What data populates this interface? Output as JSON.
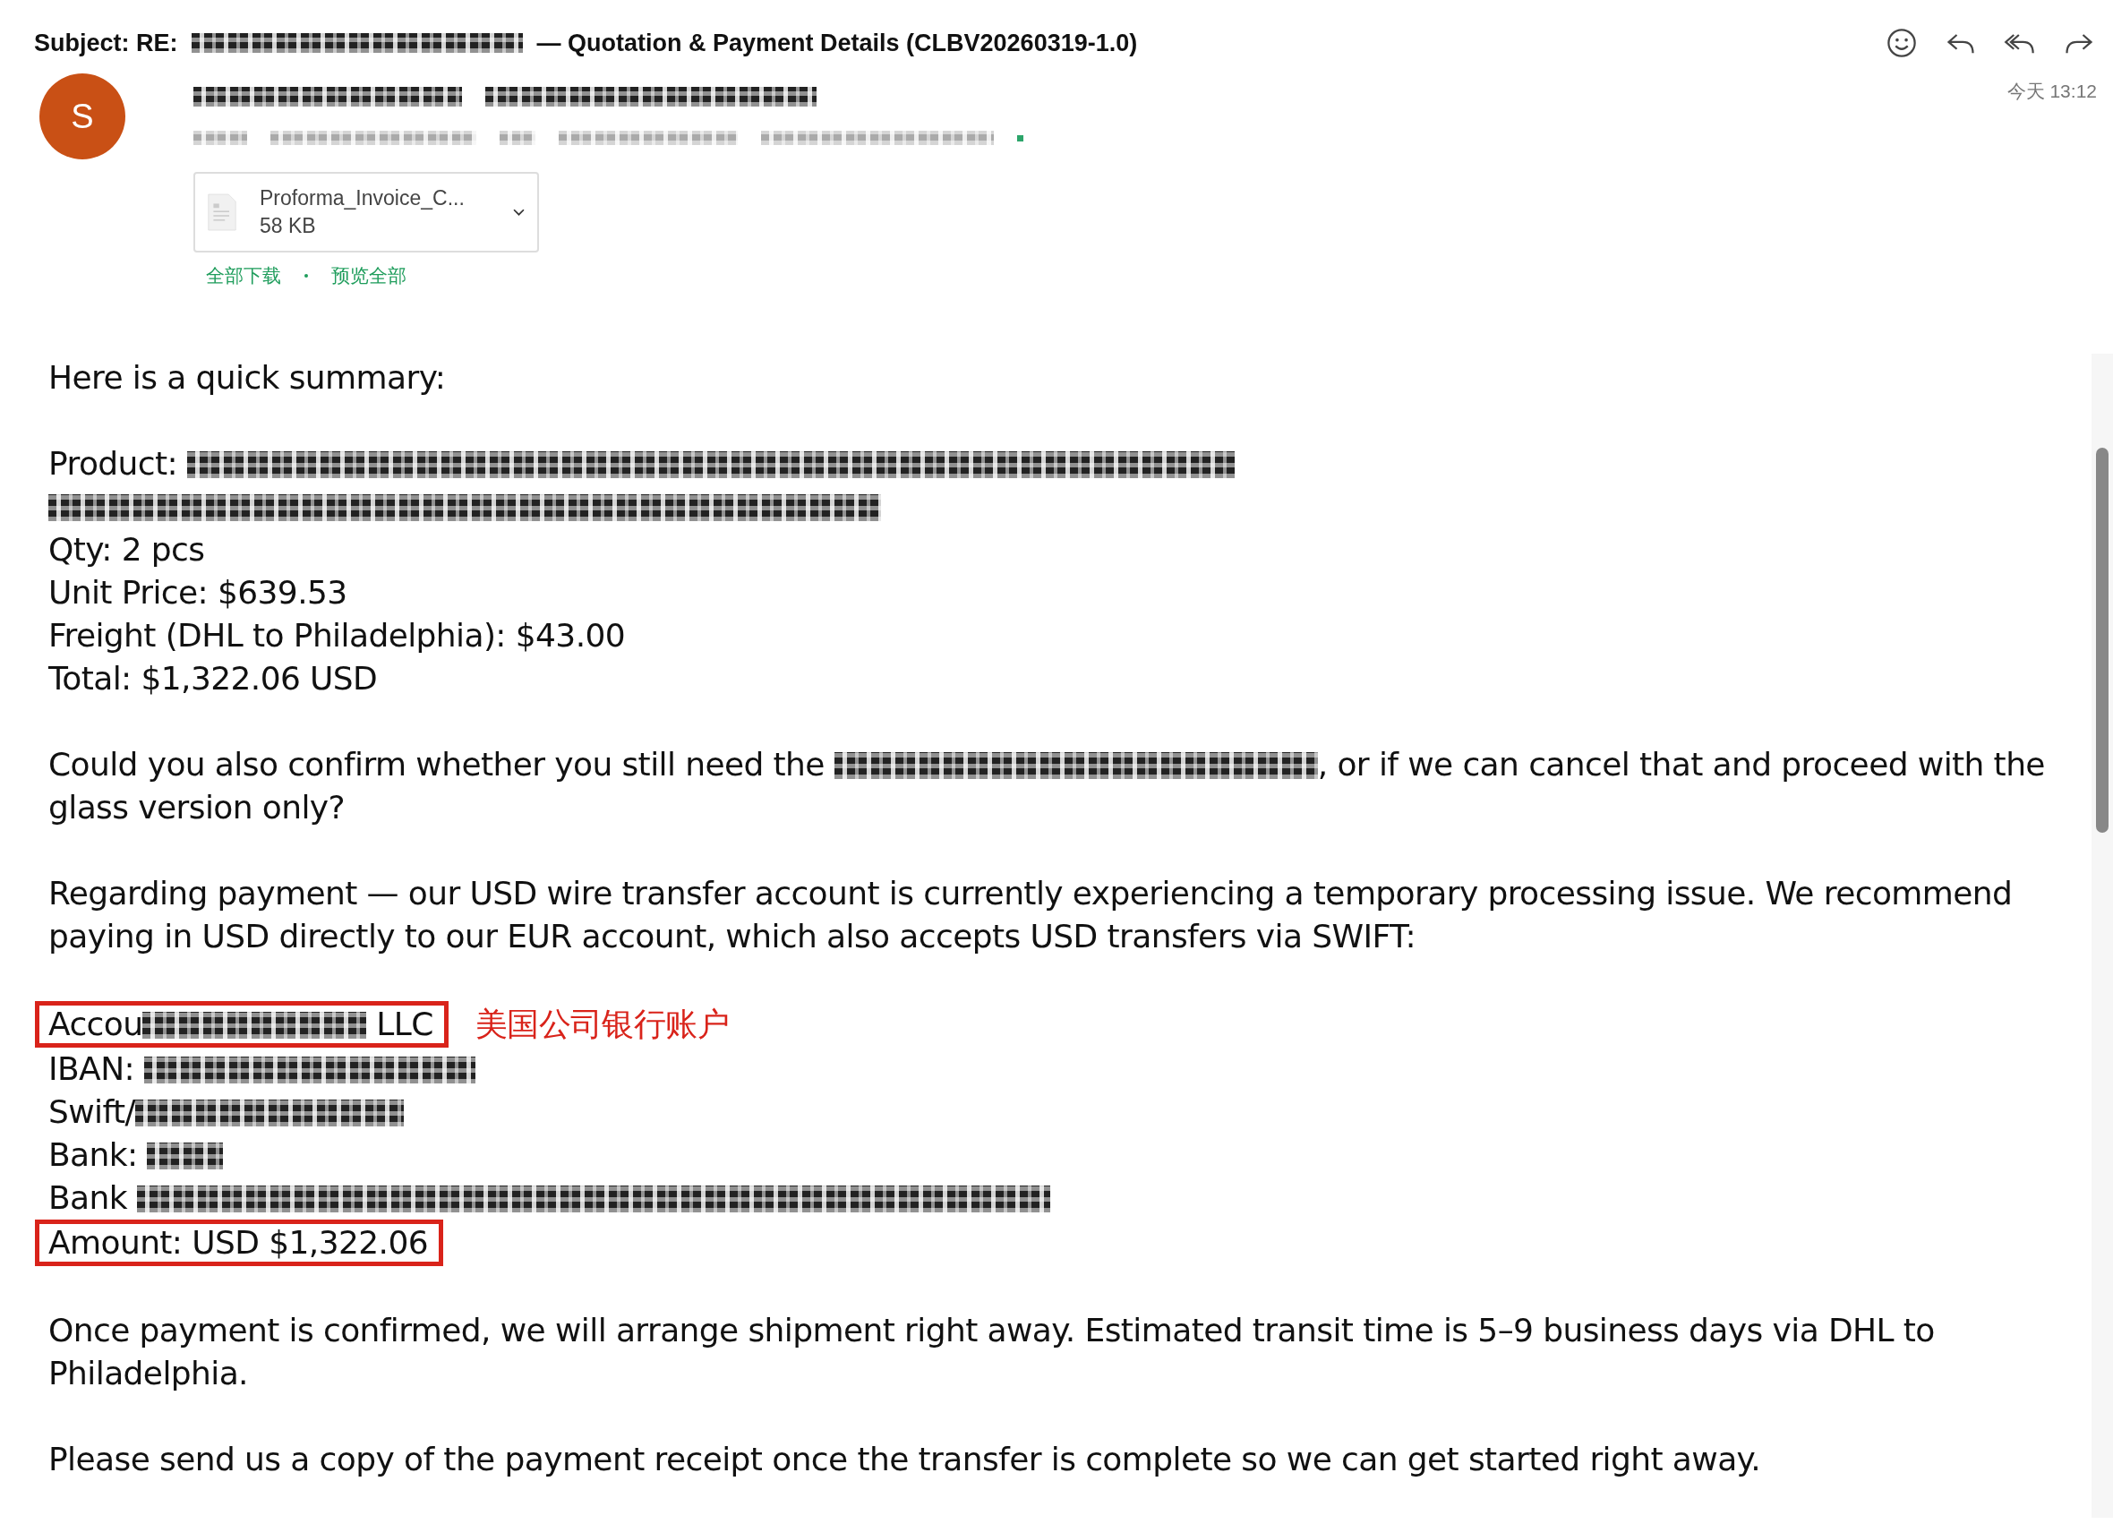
{
  "subject": [
    {
      "kind": "text",
      "text": "Subject: RE: "
    },
    {
      "kind": "redacted"
    },
    {
      "kind": "text",
      "text": " — Quotation & Payment Details (CLBV20260319-1.0)"
    }
  ],
  "toolbar": [
    {
      "kind": "emoji"
    },
    {
      "kind": "reply"
    },
    {
      "kind": "reply-all"
    },
    {
      "kind": "forward"
    }
  ],
  "sender": {
    "avatar": "S",
    "name": [
      {
        "kind": "redacted"
      },
      {
        "kind": "redacted"
      }
    ],
    "details": [
      {
        "kind": "redacted"
      },
      {
        "kind": "redacted"
      },
      {
        "kind": "redacted"
      },
      {
        "kind": "redacted"
      },
      {
        "kind": "redacted"
      }
    ],
    "time": "今天 13:12"
  },
  "attachment": {
    "name": "Proforma_Invoice_C...",
    "size": "58 KB"
  },
  "attachment_links": [
    "全部下载",
    "预览全部"
  ],
  "body": [
    {
      "lines": [
        {
          "boxed": false,
          "segments": [
            {
              "kind": "text",
              "text": "Here is a quick summary:"
            }
          ]
        }
      ]
    },
    {
      "lines": [
        {
          "boxed": false,
          "segments": [
            {
              "kind": "text",
              "text": "Product: "
            },
            {
              "kind": "redacted"
            }
          ]
        },
        {
          "boxed": false,
          "segments": [
            {
              "kind": "redacted"
            }
          ]
        },
        {
          "boxed": false,
          "segments": [
            {
              "kind": "text",
              "text": "Qty: 2 pcs"
            }
          ]
        },
        {
          "boxed": false,
          "segments": [
            {
              "kind": "text",
              "text": "Unit Price: $639.53"
            }
          ]
        },
        {
          "boxed": false,
          "segments": [
            {
              "kind": "text",
              "text": "Freight (DHL to Philadelphia): $43.00"
            }
          ]
        },
        {
          "boxed": false,
          "segments": [
            {
              "kind": "text",
              "text": "Total: $1,322.06 USD"
            }
          ]
        }
      ]
    },
    {
      "lines": [
        {
          "boxed": false,
          "segments": [
            {
              "kind": "text",
              "text": "Could you also confirm whether you still need the "
            },
            {
              "kind": "redacted"
            },
            {
              "kind": "text",
              "text": ", or if we can cancel that and proceed with the glass version only?"
            }
          ]
        }
      ]
    },
    {
      "lines": [
        {
          "boxed": false,
          "segments": [
            {
              "kind": "text",
              "text": "Regarding payment — our USD wire transfer account is currently experiencing a temporary processing issue. We recommend paying in USD directly to our EUR account, which also accepts USD transfers via SWIFT:"
            }
          ]
        }
      ]
    },
    {
      "lines": [
        {
          "boxed": true,
          "note": "美国公司银行账户",
          "segments": [
            {
              "kind": "text",
              "text": "Accou"
            },
            {
              "kind": "redacted"
            },
            {
              "kind": "text",
              "text": " LLC"
            }
          ]
        },
        {
          "boxed": false,
          "segments": [
            {
              "kind": "text",
              "text": "IBAN: "
            },
            {
              "kind": "redacted"
            }
          ]
        },
        {
          "boxed": false,
          "segments": [
            {
              "kind": "text",
              "text": "Swift/"
            },
            {
              "kind": "redacted"
            }
          ]
        },
        {
          "boxed": false,
          "segments": [
            {
              "kind": "text",
              "text": "Bank: "
            },
            {
              "kind": "redacted"
            }
          ]
        },
        {
          "boxed": false,
          "segments": [
            {
              "kind": "text",
              "text": "Bank "
            },
            {
              "kind": "redacted"
            }
          ]
        },
        {
          "boxed": true,
          "segments": [
            {
              "kind": "text",
              "text": "Amount: USD $1,322.06"
            }
          ]
        }
      ]
    },
    {
      "lines": [
        {
          "boxed": false,
          "segments": [
            {
              "kind": "text",
              "text": "Once payment is confirmed, we will arrange shipment right away. Estimated transit time is 5–9 business days via DHL to Philadelphia."
            }
          ]
        }
      ]
    },
    {
      "lines": [
        {
          "boxed": false,
          "segments": [
            {
              "kind": "text",
              "text": "Please send us a copy of the payment receipt once the transfer is complete so we can get started right away."
            }
          ]
        }
      ]
    }
  ]
}
